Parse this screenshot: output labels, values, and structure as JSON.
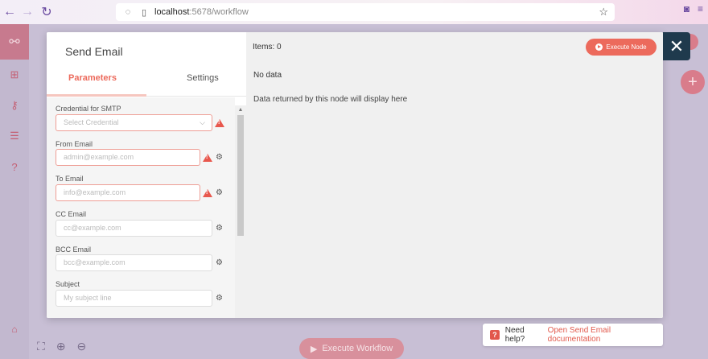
{
  "browser": {
    "url_host": "localhost",
    "url_path": ":5678/workflow"
  },
  "modal": {
    "node_title": "Send Email",
    "tabs": [
      {
        "label": "Parameters",
        "active": true
      },
      {
        "label": "Settings",
        "active": false
      }
    ],
    "fields": [
      {
        "label": "Credential for SMTP",
        "placeholder": "Select Credential"
      },
      {
        "label": "From Email",
        "placeholder": "admin@example.com"
      },
      {
        "label": "To Email",
        "placeholder": "info@example.com"
      },
      {
        "label": "CC Email",
        "placeholder": "cc@example.com"
      },
      {
        "label": "BCC Email",
        "placeholder": "bcc@example.com"
      },
      {
        "label": "Subject",
        "placeholder": "My subject line"
      }
    ],
    "output": {
      "items_label": "Items: 0",
      "execute_node_label": "Execute Node",
      "no_data_title": "No data",
      "no_data_desc": "Data returned by this node will display here"
    }
  },
  "canvas": {
    "execute_workflow_label": "Execute Workflow"
  },
  "help": {
    "prefix": "Need help?",
    "link": "Open Send Email documentation"
  },
  "colors": {
    "accent": "#ec6a5c",
    "close_bg": "#1f3a4d",
    "overlay": "#c8bfd5"
  }
}
